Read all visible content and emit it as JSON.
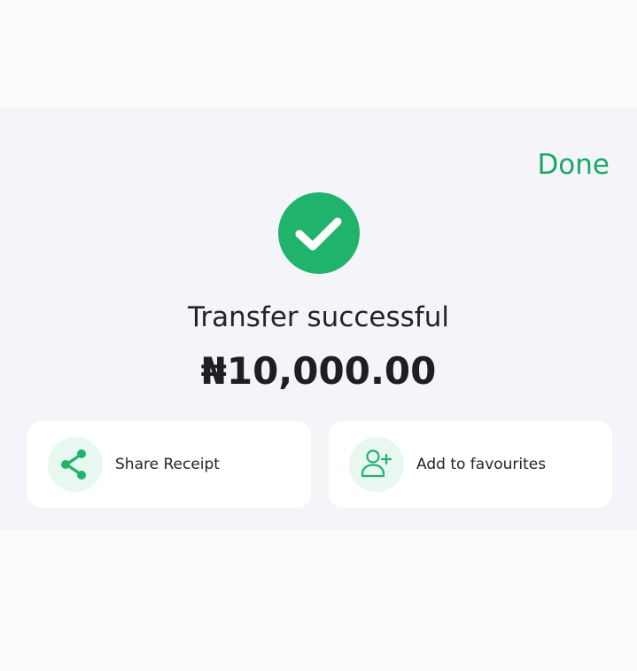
{
  "header": {
    "done_label": "Done"
  },
  "status": {
    "icon": "check-circle-icon",
    "title": "Transfer successful",
    "amount": "₦10,000.00"
  },
  "actions": [
    {
      "label": "Share Receipt",
      "icon": "share-icon"
    },
    {
      "label": "Add to favourites",
      "icon": "add-user-icon"
    }
  ],
  "colors": {
    "accent": "#1fb36c",
    "accent_text": "#19a967",
    "icon_bg": "#e9f7f1",
    "band_bg": "#f5f5f9",
    "page_bg": "#fbfbfc",
    "text": "#222428"
  }
}
